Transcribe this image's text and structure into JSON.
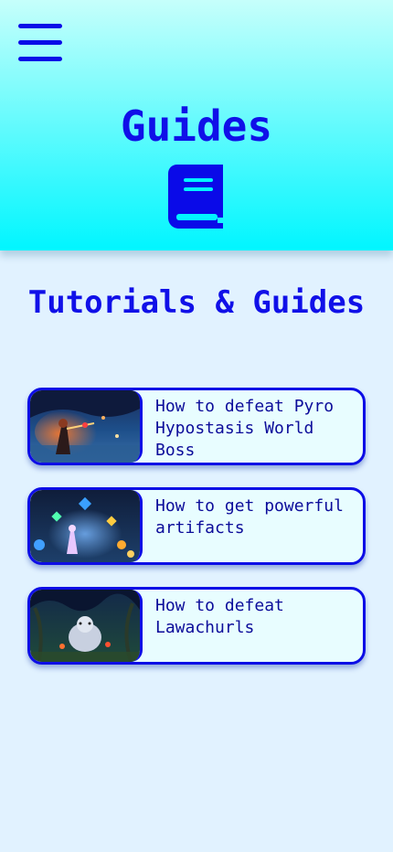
{
  "header": {
    "title": "Guides",
    "menu_icon": "hamburger-menu-icon",
    "title_icon": "book-icon",
    "accent_color": "#0a0ae8",
    "gradient": [
      "#c6fffb",
      "#00f6ff"
    ]
  },
  "section": {
    "title": "Tutorials & Guides"
  },
  "guides": [
    {
      "label": "How to defeat Pyro Hypostasis World Boss",
      "thumbnail": "pyro-hypostasis-thumbnail"
    },
    {
      "label": "How to get powerful artifacts",
      "thumbnail": "artifacts-thumbnail"
    },
    {
      "label": "How to defeat Lawachurls",
      "thumbnail": "lawachurl-thumbnail"
    }
  ]
}
